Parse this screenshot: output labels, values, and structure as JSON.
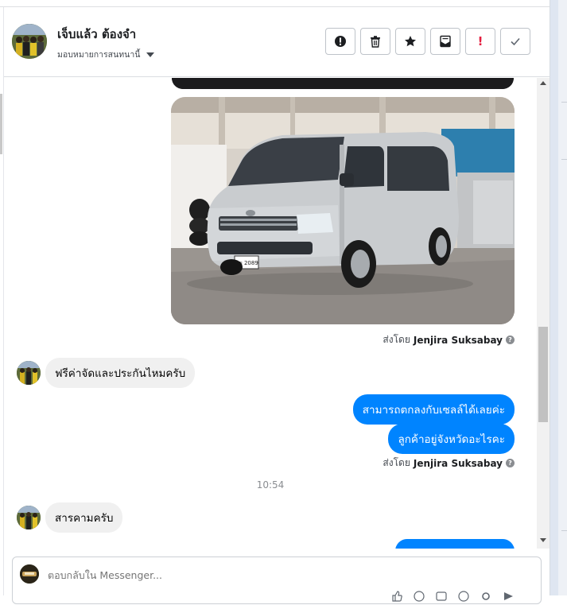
{
  "header": {
    "contact_name": "เจ็บแล้ว ต้องจำ",
    "assign_label": "มอบหมายการสนทนานี้",
    "actions": [
      {
        "icon": "alert-circle-icon",
        "label": ""
      },
      {
        "icon": "trash-icon",
        "label": ""
      },
      {
        "icon": "star-icon",
        "label": ""
      },
      {
        "icon": "mail-icon",
        "label": ""
      },
      {
        "icon": "exclamation-icon",
        "label": "!"
      },
      {
        "icon": "check-icon",
        "label": ""
      }
    ]
  },
  "conversation": {
    "photo_sent_by_prefix": "ส่งโดย",
    "photo_sent_by_name": "Jenjira Suksabay",
    "photo_plate": "นข 2089",
    "incoming_1": "ฟรีค่าจัดและประกันไหมครับ",
    "outgoing_1": "สามารถตกลงกับเซลล์ได้เลยค่ะ",
    "outgoing_2": "ลูกค้าอยู่จังหวัดอะไรคะ",
    "outgoing_sent_by_prefix": "ส่งโดย",
    "outgoing_sent_by_name": "Jenjira Suksabay",
    "help_mark": "?",
    "timestamp": "10:54",
    "incoming_2": "สารคามครับ"
  },
  "composer": {
    "placeholder": "ตอบกลับใน Messenger..."
  },
  "colors": {
    "outgoing_bubble": "#0084ff",
    "incoming_bubble": "#f0f0f0",
    "van_body": "#c9cccf"
  }
}
